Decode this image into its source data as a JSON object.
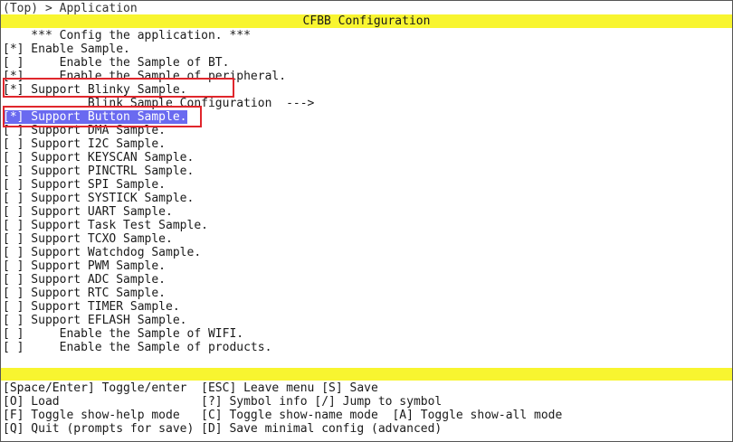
{
  "breadcrumb": "(Top) > Application",
  "title": "CFBB Configuration",
  "items": [
    {
      "text": "    *** Config the application. ***"
    },
    {
      "text": "[*] Enable Sample."
    },
    {
      "text": "[ ]     Enable the Sample of BT."
    },
    {
      "text": "[*]     Enable the Sample of peripheral."
    },
    {
      "text": "[*] Support Blinky Sample."
    },
    {
      "text": "            Blink Sample Configuration  --->"
    },
    {
      "text": "[*] Support Button Sample."
    },
    {
      "text": "[ ] Support DMA Sample."
    },
    {
      "text": "[ ] Support I2C Sample."
    },
    {
      "text": "[ ] Support KEYSCAN Sample."
    },
    {
      "text": "[ ] Support PINCTRL Sample."
    },
    {
      "text": "[ ] Support SPI Sample."
    },
    {
      "text": "[ ] Support SYSTICK Sample."
    },
    {
      "text": "[ ] Support UART Sample."
    },
    {
      "text": "[ ] Support Task Test Sample."
    },
    {
      "text": "[ ] Support TCXO Sample."
    },
    {
      "text": "[ ] Support Watchdog Sample."
    },
    {
      "text": "[ ] Support PWM Sample."
    },
    {
      "text": "[ ] Support ADC Sample."
    },
    {
      "text": "[ ] Support RTC Sample."
    },
    {
      "text": "[ ] Support TIMER Sample."
    },
    {
      "text": "[ ] Support EFLASH Sample."
    },
    {
      "text": "[ ]     Enable the Sample of WIFI."
    },
    {
      "text": "[ ]     Enable the Sample of products."
    }
  ],
  "selected_index": 6,
  "help_lines": [
    "[Space/Enter] Toggle/enter  [ESC] Leave menu [S] Save",
    "[O] Load                    [?] Symbol info [/] Jump to symbol",
    "[F] Toggle show-help mode   [C] Toggle show-name mode  [A] Toggle show-all mode",
    "[Q] Quit (prompts for save) [D] Save minimal config (advanced)"
  ],
  "colors": {
    "title_bar": "#f8f530",
    "selection": "#6a6af0",
    "annotation_box": "#e0262c"
  }
}
